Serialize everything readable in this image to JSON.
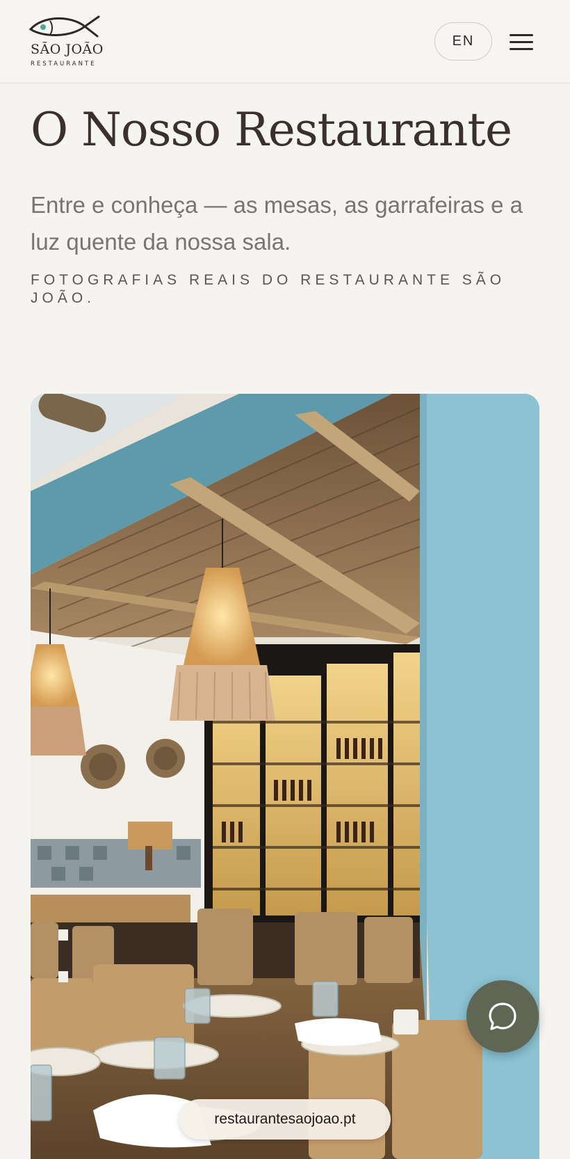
{
  "header": {
    "logo_name": "SÃO JOÃO",
    "logo_sub": "RESTAURANTE",
    "language_button": "EN",
    "menu_icon": "hamburger-menu-icon",
    "logo_icon": "fish-logo-icon"
  },
  "main": {
    "title": "O Nosso Restaurante",
    "lead": "Entre e conheça — as mesas, as garrafeiras e a luz quente da nossa sala.",
    "caption": "FOTOGRAFIAS REAIS DO RESTAURANTE SÃO JOÃO."
  },
  "chat": {
    "icon": "chat-bubble-icon"
  },
  "browser": {
    "url": "restaurantesaojoao.pt"
  },
  "colors": {
    "background": "#f6f4f1",
    "accent": "#5f6654",
    "text": "#3a302c",
    "muted": "#7a7470",
    "wall_blue": "#8cc2d2"
  }
}
